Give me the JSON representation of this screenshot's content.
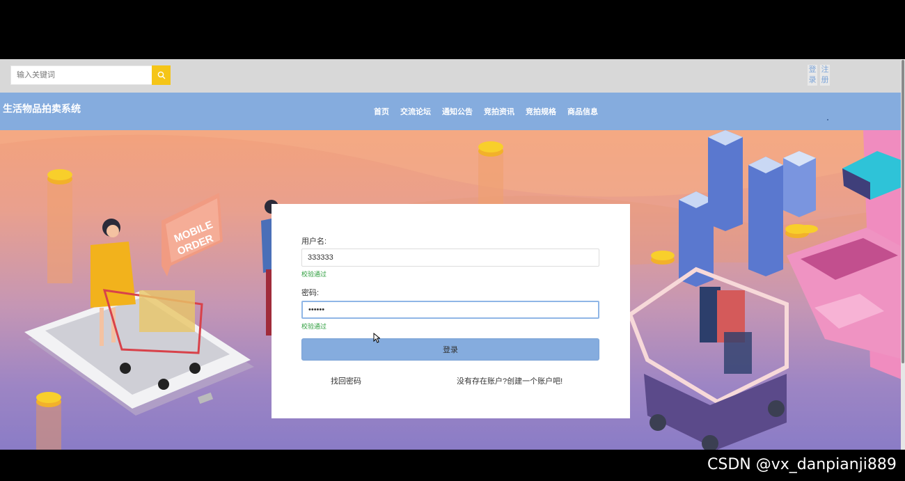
{
  "topbar": {
    "search_placeholder": "输入关键词",
    "search_icon": "search-icon",
    "login_label": "登录",
    "register_label": "注册"
  },
  "navbar": {
    "site_title": "生活物品拍卖系统",
    "items": [
      "首页",
      "交流论坛",
      "通知公告",
      "竞拍资讯",
      "竞拍规格",
      "商品信息"
    ]
  },
  "hero": {
    "sign_text": [
      "MOBILE",
      "ORDER"
    ]
  },
  "login_form": {
    "username_label": "用户名:",
    "username_value": "333333",
    "username_status": "校验通过",
    "password_label": "密码:",
    "password_value": "••••••",
    "password_status": "校验通过",
    "submit_label": "登录",
    "forgot_link": "找回密码",
    "register_link": "没有存在账户?创建一个账户吧!"
  },
  "watermark": "CSDN @vx_danpianji889",
  "colors": {
    "nav_bg": "#85acde",
    "search_btn": "#f5c518",
    "valid": "#2e9e3e"
  }
}
